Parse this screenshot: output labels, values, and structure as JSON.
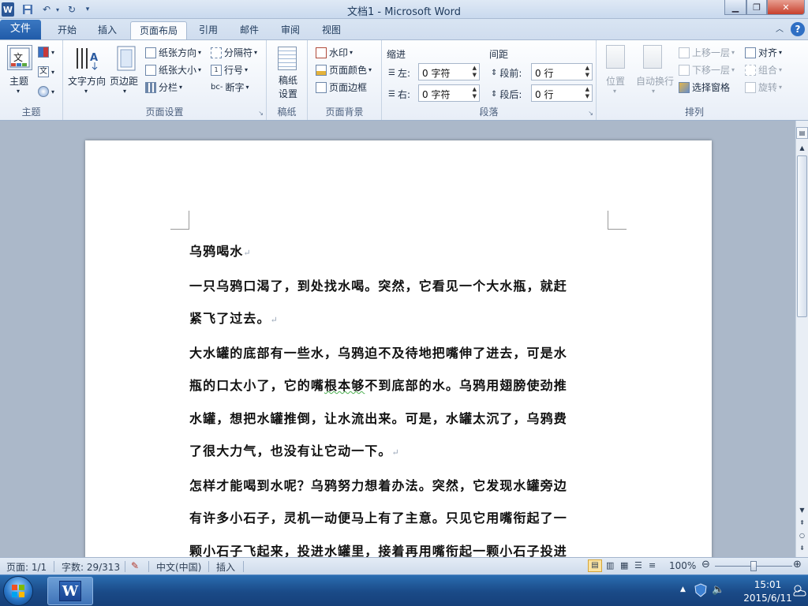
{
  "window": {
    "title": "文档1 - Microsoft Word"
  },
  "tabs": {
    "file": "文件",
    "items": [
      "开始",
      "插入",
      "页面布局",
      "引用",
      "邮件",
      "审阅",
      "视图"
    ],
    "active": "页面布局"
  },
  "ribbon": {
    "theme": {
      "button": "主题",
      "group": "主题"
    },
    "page_setup": {
      "text_direction": "文字方向",
      "margins": "页边距",
      "orientation": "纸张方向",
      "size": "纸张大小",
      "columns": "分栏",
      "breaks": "分隔符",
      "line_numbers": "行号",
      "hyphenation": "断字",
      "group": "页面设置"
    },
    "draft": {
      "button": "稿纸\n设置",
      "group": "稿纸"
    },
    "page_background": {
      "watermark": "水印",
      "page_color": "页面颜色",
      "page_border": "页面边框",
      "group": "页面背景"
    },
    "paragraph": {
      "indent_label": "缩进",
      "left_label": "左:",
      "left_value": "0 字符",
      "right_label": "右:",
      "right_value": "0 字符",
      "spacing_label": "间距",
      "before_label": "段前:",
      "before_value": "0 行",
      "after_label": "段后:",
      "after_value": "0 行",
      "group": "段落"
    },
    "arrange": {
      "position": "位置",
      "wrap": "自动换行",
      "bring_forward": "上移一层",
      "send_backward": "下移一层",
      "selection_pane": "选择窗格",
      "align": "对齐",
      "group_btn": "组合",
      "rotate": "旋转",
      "group": "排列"
    }
  },
  "document": {
    "title": "乌鸦喝水",
    "p1_l1": "一只乌鸦口渴了，到处找水喝。突然，它看见一个大水瓶，就赶",
    "p1_l2": "紧飞了过去。",
    "p2_l1": "大水罐的底部有一些水，乌鸦迫不及待地把嘴伸了进去，可是水",
    "p2_l2a": "瓶的口太小了，它的嘴",
    "p2_l2b": "根本够",
    "p2_l2c": "不到底部的水。乌鸦用翅膀使劲推",
    "p2_l3": "水罐，想把水罐推倒，让水流出来。可是，水罐太沉了，乌鸦费",
    "p2_l4": "了很大力气，也没有让它动一下。",
    "p3_l1": "怎样才能喝到水呢？乌鸦努力想着办法。突然，它发现水罐旁边",
    "p3_l2": "有许多小石子，灵机一动便马上有了主意。只见它用嘴衔起了一",
    "p3_l3": "颗小石子飞起来，投进水罐里，接着再用嘴衔起一颗小石子投进",
    "para_mark": "↵"
  },
  "status": {
    "page": "页面: 1/1",
    "words": "字数: 29/313",
    "language": "中文(中国)",
    "mode": "插入",
    "zoom": "100%"
  },
  "taskbar": {
    "time": "15:01",
    "date": "2015/6/11"
  }
}
